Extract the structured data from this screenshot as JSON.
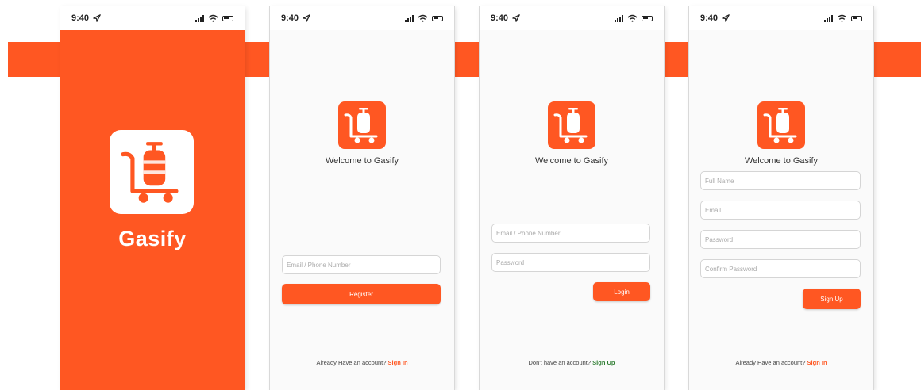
{
  "brand": {
    "name": "Gasify",
    "accent": "#ff5722",
    "signin_color": "#ff5722",
    "signup_color": "#2e7d32"
  },
  "screens": [
    {
      "time": "9:40"
    },
    {
      "time": "9:40",
      "welcome": "Welcome to Gasify",
      "email_placeholder": "Email / Phone Number",
      "button": "Register",
      "footer_text": "Already Have an account?",
      "footer_link": "Sign In"
    },
    {
      "time": "9:40",
      "welcome": "Welcome to Gasify",
      "email_placeholder": "Email / Phone Number",
      "password_placeholder": "Password",
      "button": "Login",
      "footer_text": "Don't have an account?",
      "footer_link": "Sign Up"
    },
    {
      "time": "9:40",
      "welcome": "Welcome to Gasify",
      "fullname_placeholder": "Full Name",
      "email_placeholder": "Email",
      "password_placeholder": "Password",
      "confirm_placeholder": "Confirm Password",
      "button": "Sign Up",
      "footer_text": "Already Have an account?",
      "footer_link": "Sign In"
    }
  ],
  "icons": {
    "logo": "gas-cylinder-cart-icon",
    "location": "location-arrow-icon",
    "signal": "signal-icon",
    "wifi": "wifi-icon",
    "battery": "battery-icon"
  }
}
